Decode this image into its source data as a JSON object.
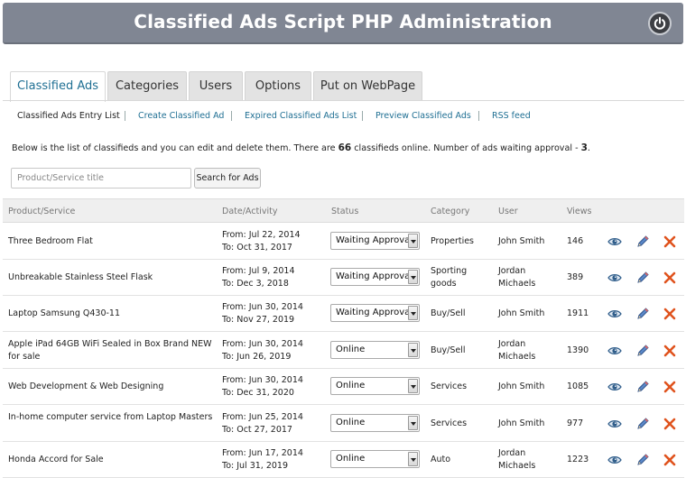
{
  "header": {
    "title": "Classified Ads Script PHP Administration",
    "power_icon": "power-icon"
  },
  "tabs": [
    {
      "label": "Classified Ads",
      "active": true
    },
    {
      "label": "Categories",
      "active": false
    },
    {
      "label": "Users",
      "active": false
    },
    {
      "label": "Options",
      "active": false
    },
    {
      "label": "Put on WebPage",
      "active": false
    }
  ],
  "subnav": [
    {
      "label": "Classified Ads Entry List",
      "current": true
    },
    {
      "label": "Create Classified Ad",
      "current": false
    },
    {
      "label": "Expired Classified Ads List",
      "current": false
    },
    {
      "label": "Preview Classified Ads",
      "current": false
    },
    {
      "label": "RSS feed",
      "current": false
    }
  ],
  "info": {
    "prefix": "Below is the list of classifieds and you can edit and delete them. There are ",
    "count_online": "66",
    "middle": " classifieds online. Number of ads waiting approval - ",
    "count_waiting": "3",
    "suffix": "."
  },
  "search": {
    "placeholder": "Product/Service title",
    "value": "",
    "button_label": "Search for Ads"
  },
  "table": {
    "headers": {
      "product": "Product/Service",
      "date": "Date/Activity",
      "status": "Status",
      "category": "Category",
      "user": "User",
      "views": "Views"
    },
    "rows": [
      {
        "title": "Three Bedroom Flat",
        "from": "From: Jul 22, 2014",
        "to": "To: Oct 31, 2017",
        "status": "Waiting Approval",
        "category": "Properties",
        "user": "John Smith",
        "views": "146"
      },
      {
        "title": "Unbreakable Stainless Steel Flask",
        "from": "From: Jul 9, 2014",
        "to": "To: Dec 3, 2018",
        "status": "Waiting Approval",
        "category": "Sporting goods",
        "user": "Jordan Michaels",
        "views": "389"
      },
      {
        "title": "Laptop Samsung Q430-11",
        "from": "From: Jun 30, 2014",
        "to": "To: Nov 27, 2019",
        "status": "Waiting Approval",
        "category": "Buy/Sell",
        "user": "John Smith",
        "views": "1911"
      },
      {
        "title": "Apple iPad 64GB WiFi Sealed in Box Brand NEW for sale",
        "from": "From: Jun 30, 2014",
        "to": "To: Jun 26, 2019",
        "status": "Online",
        "category": "Buy/Sell",
        "user": "Jordan Michaels",
        "views": "1390"
      },
      {
        "title": "Web Development & Web Designing",
        "from": "From: Jun 30, 2014",
        "to": "To: Dec 31, 2020",
        "status": "Online",
        "category": "Services",
        "user": "John Smith",
        "views": "1085"
      },
      {
        "title": "In-home computer service from Laptop Masters",
        "from": "From: Jun 25, 2014",
        "to": "To: Oct 27, 2017",
        "status": "Online",
        "category": "Services",
        "user": "John Smith",
        "views": "977"
      },
      {
        "title": "Honda Accord for Sale",
        "from": "From: Jun 17, 2014",
        "to": "To: Jul 31, 2019",
        "status": "Online",
        "category": "Auto",
        "user": "Jordan Michaels",
        "views": "1223"
      }
    ],
    "action_icons": [
      "eye-icon",
      "pencil-icon",
      "delete-x-icon"
    ]
  },
  "colors": {
    "header_bg": "#808693",
    "link": "#1f6f93",
    "delete": "#e0531e",
    "view": "#2f5d8a"
  }
}
